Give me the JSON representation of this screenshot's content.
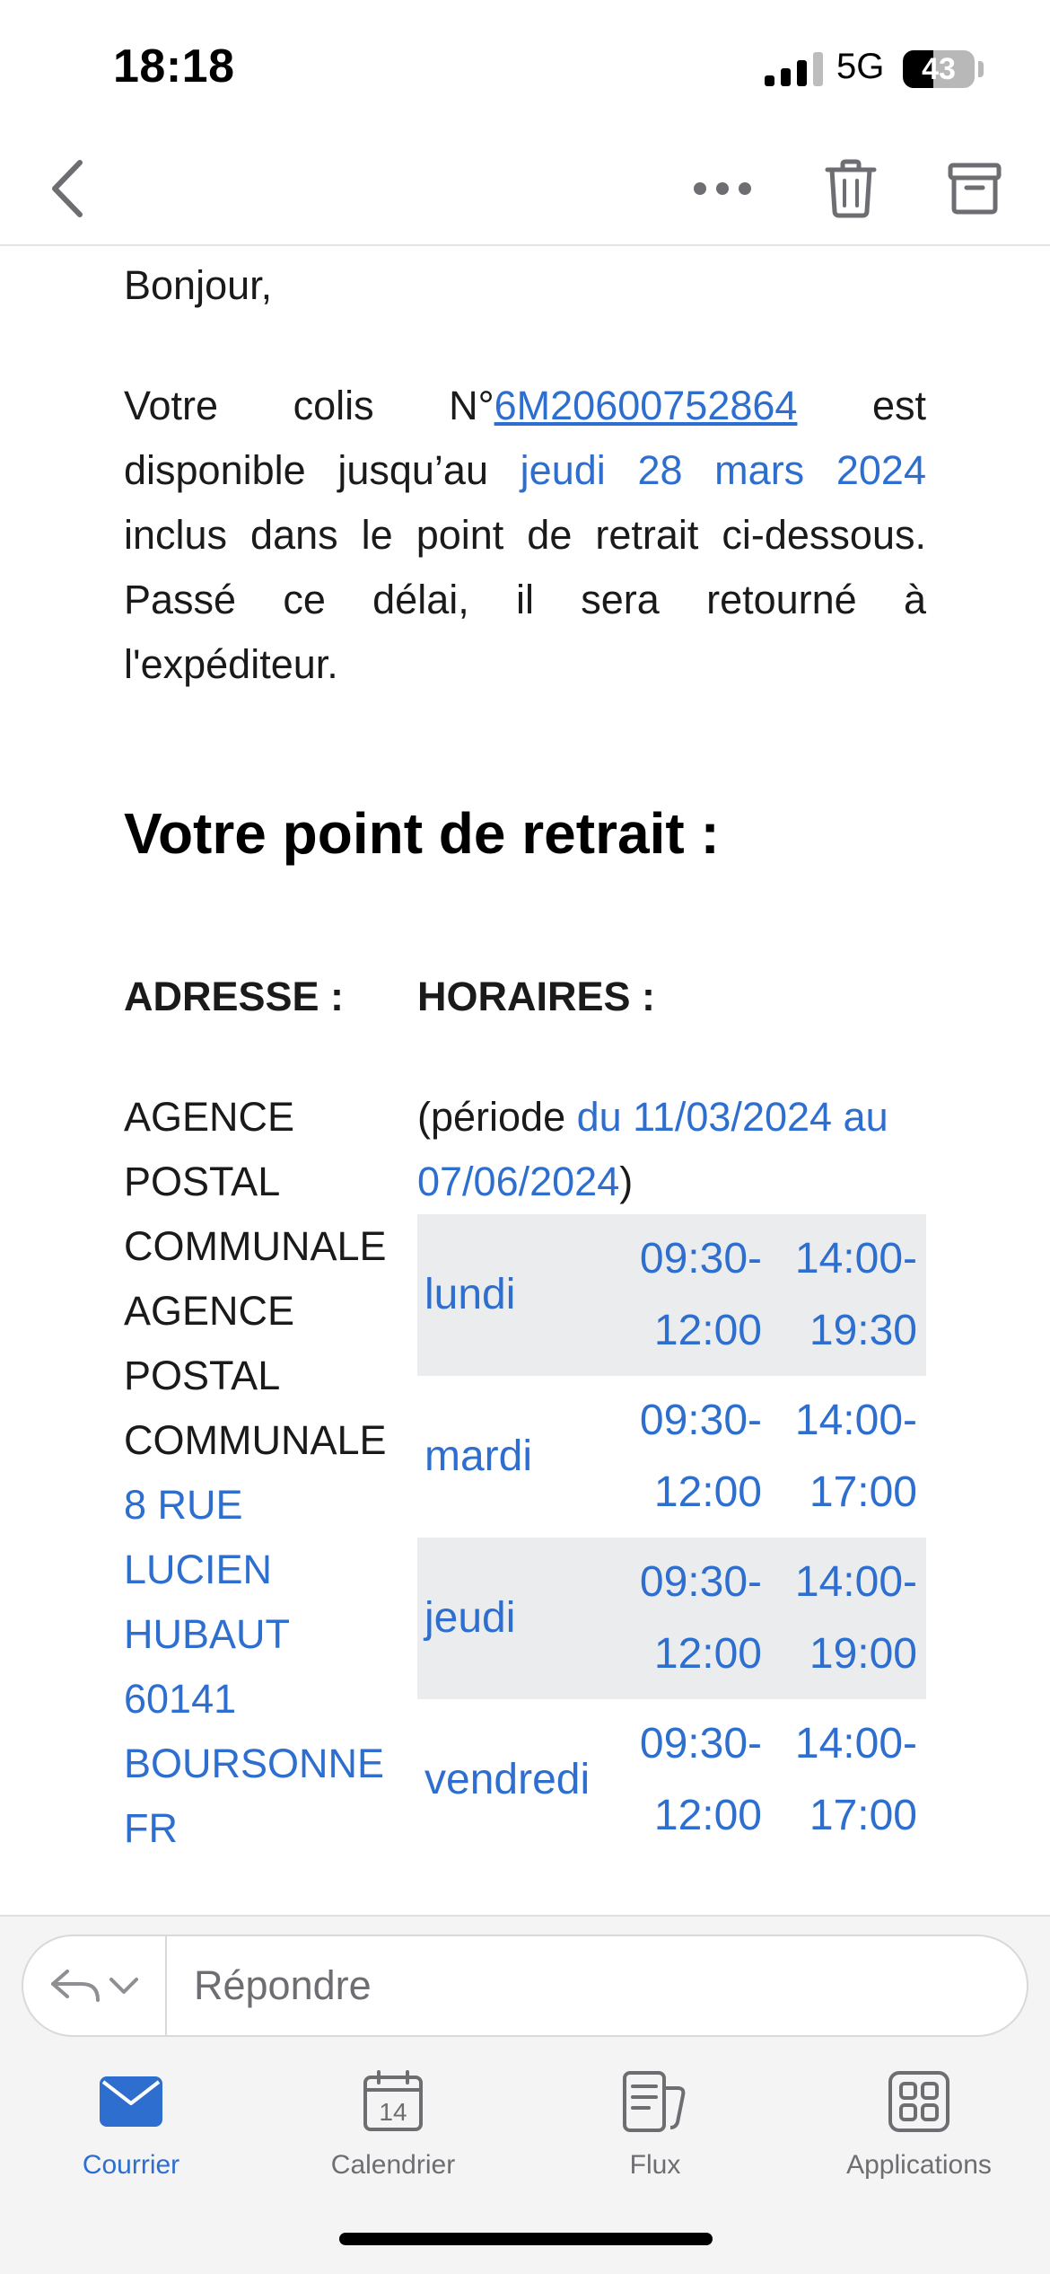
{
  "status_bar": {
    "time": "18:18",
    "network": "5G",
    "battery": "43",
    "battery_level": 0.43
  },
  "toolbar": {
    "back_icon": "chevron-left-icon",
    "more_icon": "ellipsis-icon",
    "trash_icon": "trash-icon",
    "archive_icon": "archive-icon"
  },
  "email": {
    "greeting": "Bonjour,",
    "para_prefix": "Votre colis N°",
    "tracking_number": "6M20600752864",
    "para_mid": " est disponible jusqu’au ",
    "deadline": "jeudi 28 mars 2024",
    "para_suffix": " inclus dans le point de retrait ci-dessous. Passé ce délai, il sera retourné à l'expéditeur.",
    "heading": "Votre point de retrait :",
    "address_title": "ADRESSE :",
    "hours_title": "HORAIRES :",
    "address_lines": [
      "AGENCE",
      "POSTAL",
      "COMMUNALE",
      "AGENCE",
      "POSTAL",
      "COMMUNALE",
      "8 RUE",
      "LUCIEN",
      "HUBAUT",
      "60141",
      "BOURSONNE",
      "FR"
    ],
    "period_prefix": "(période ",
    "period_range": "du 11/03/2024 au 07/06/2024",
    "period_suffix": ")",
    "hours": [
      {
        "day": "lundi",
        "am_start": "09:30-",
        "am_end": "12:00",
        "pm_start": "14:00-",
        "pm_end": "19:30"
      },
      {
        "day": "mardi",
        "am_start": "09:30-",
        "am_end": "12:00",
        "pm_start": "14:00-",
        "pm_end": "17:00"
      },
      {
        "day": "jeudi",
        "am_start": "09:30-",
        "am_end": "12:00",
        "pm_start": "14:00-",
        "pm_end": "19:00"
      },
      {
        "day": "vendredi",
        "am_start": "09:30-",
        "am_end": "12:00",
        "pm_start": "14:00-",
        "pm_end": "17:00"
      }
    ]
  },
  "reply": {
    "placeholder": "Répondre"
  },
  "tabs": [
    {
      "label": "Courrier",
      "icon": "mail-icon",
      "active": true
    },
    {
      "label": "Calendrier",
      "icon": "calendar-icon",
      "date": "14"
    },
    {
      "label": "Flux",
      "icon": "feed-icon"
    },
    {
      "label": "Applications",
      "icon": "apps-grid-icon"
    }
  ],
  "colors": {
    "accent": "#2d6ecf",
    "shaded_row": "#ebeced",
    "tab_inactive": "#6d6d72"
  }
}
